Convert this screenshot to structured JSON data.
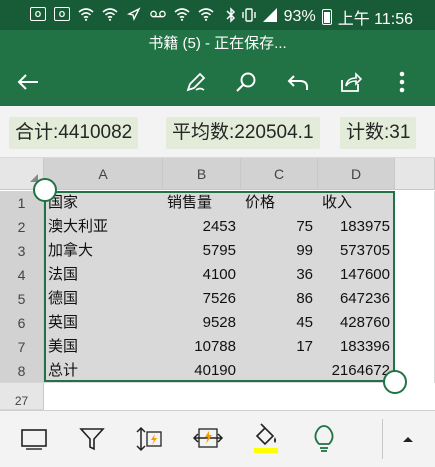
{
  "status_bar": {
    "battery": "93%",
    "time": "上午 11:56"
  },
  "title": "书籍 (5) - 正在保存...",
  "toolbar": {
    "back": "back-arrow-icon",
    "draw": "pen-icon",
    "search": "search-icon",
    "undo": "undo-icon",
    "share": "share-icon",
    "more": "more-icon"
  },
  "stats": {
    "sum": "合计:4410082",
    "average": "平均数:220504.1",
    "count": "计数:31"
  },
  "grid": {
    "columns": [
      "A",
      "B",
      "C",
      "D"
    ],
    "rows": [
      "1",
      "2",
      "3",
      "4",
      "5",
      "6",
      "7",
      "8",
      "27"
    ],
    "headers": [
      "国家",
      "销售量",
      "价格",
      "收入"
    ],
    "data": [
      [
        "澳大利亚",
        "2453",
        "75",
        "183975"
      ],
      [
        "加拿大",
        "5795",
        "99",
        "573705"
      ],
      [
        "法国",
        "4100",
        "36",
        "147600"
      ],
      [
        "德国",
        "7526",
        "86",
        "647236"
      ],
      [
        "英国",
        "9528",
        "45",
        "428760"
      ],
      [
        "美国",
        "10788",
        "17",
        "183396"
      ],
      [
        "总计",
        "40190",
        "",
        "2164672"
      ]
    ]
  },
  "bottom_toolbar": {
    "items": [
      "chart-icon",
      "filter-icon",
      "sort-icon",
      "flash-fill-icon",
      "fill-color-icon",
      "ideas-icon",
      "expand-icon"
    ],
    "fill_color": "#ffff00"
  },
  "colors": {
    "accent": "#217346",
    "status_bar": "#185c37",
    "stats_background": "#e2ecd9"
  }
}
